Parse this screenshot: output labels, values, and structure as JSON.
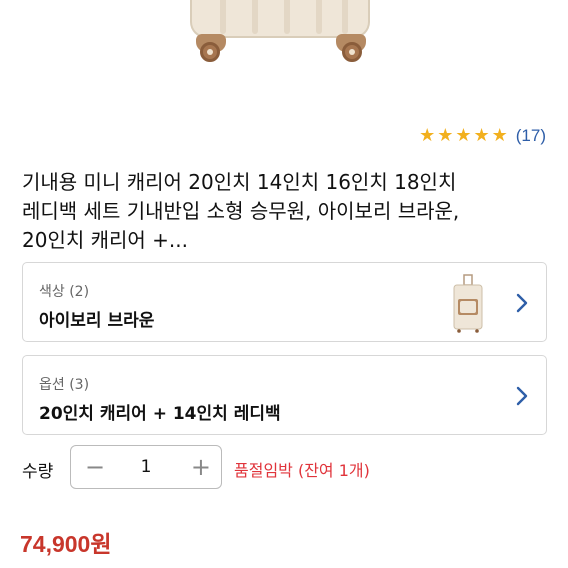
{
  "rating": {
    "stars": 5,
    "review_count": "(17)",
    "star_color": "#f2b01e",
    "count_color": "#2e5ea8"
  },
  "product": {
    "title_lines": [
      "기내용 미니 캐리어 20인치 14인치 16인치 18인치",
      "레디백 세트 기내반입 소형 승무원, 아이보리 브라운,",
      "20인치 캐리어 +..."
    ]
  },
  "options": {
    "color": {
      "label": "색상 (2)",
      "value": "아이보리 브라운",
      "icon": "chevron-right-icon"
    },
    "variant": {
      "label": "옵션 (3)",
      "value": "20인치 캐리어 + 14인치 레디백",
      "icon": "chevron-right-icon"
    }
  },
  "quantity": {
    "label": "수량",
    "value": "1",
    "minus": "−",
    "plus": "+"
  },
  "stock": {
    "warning": "품절임박 (잔여 1개)",
    "color": "#e0343b"
  },
  "price": {
    "amount": "74,900원",
    "color": "#c8362b"
  }
}
